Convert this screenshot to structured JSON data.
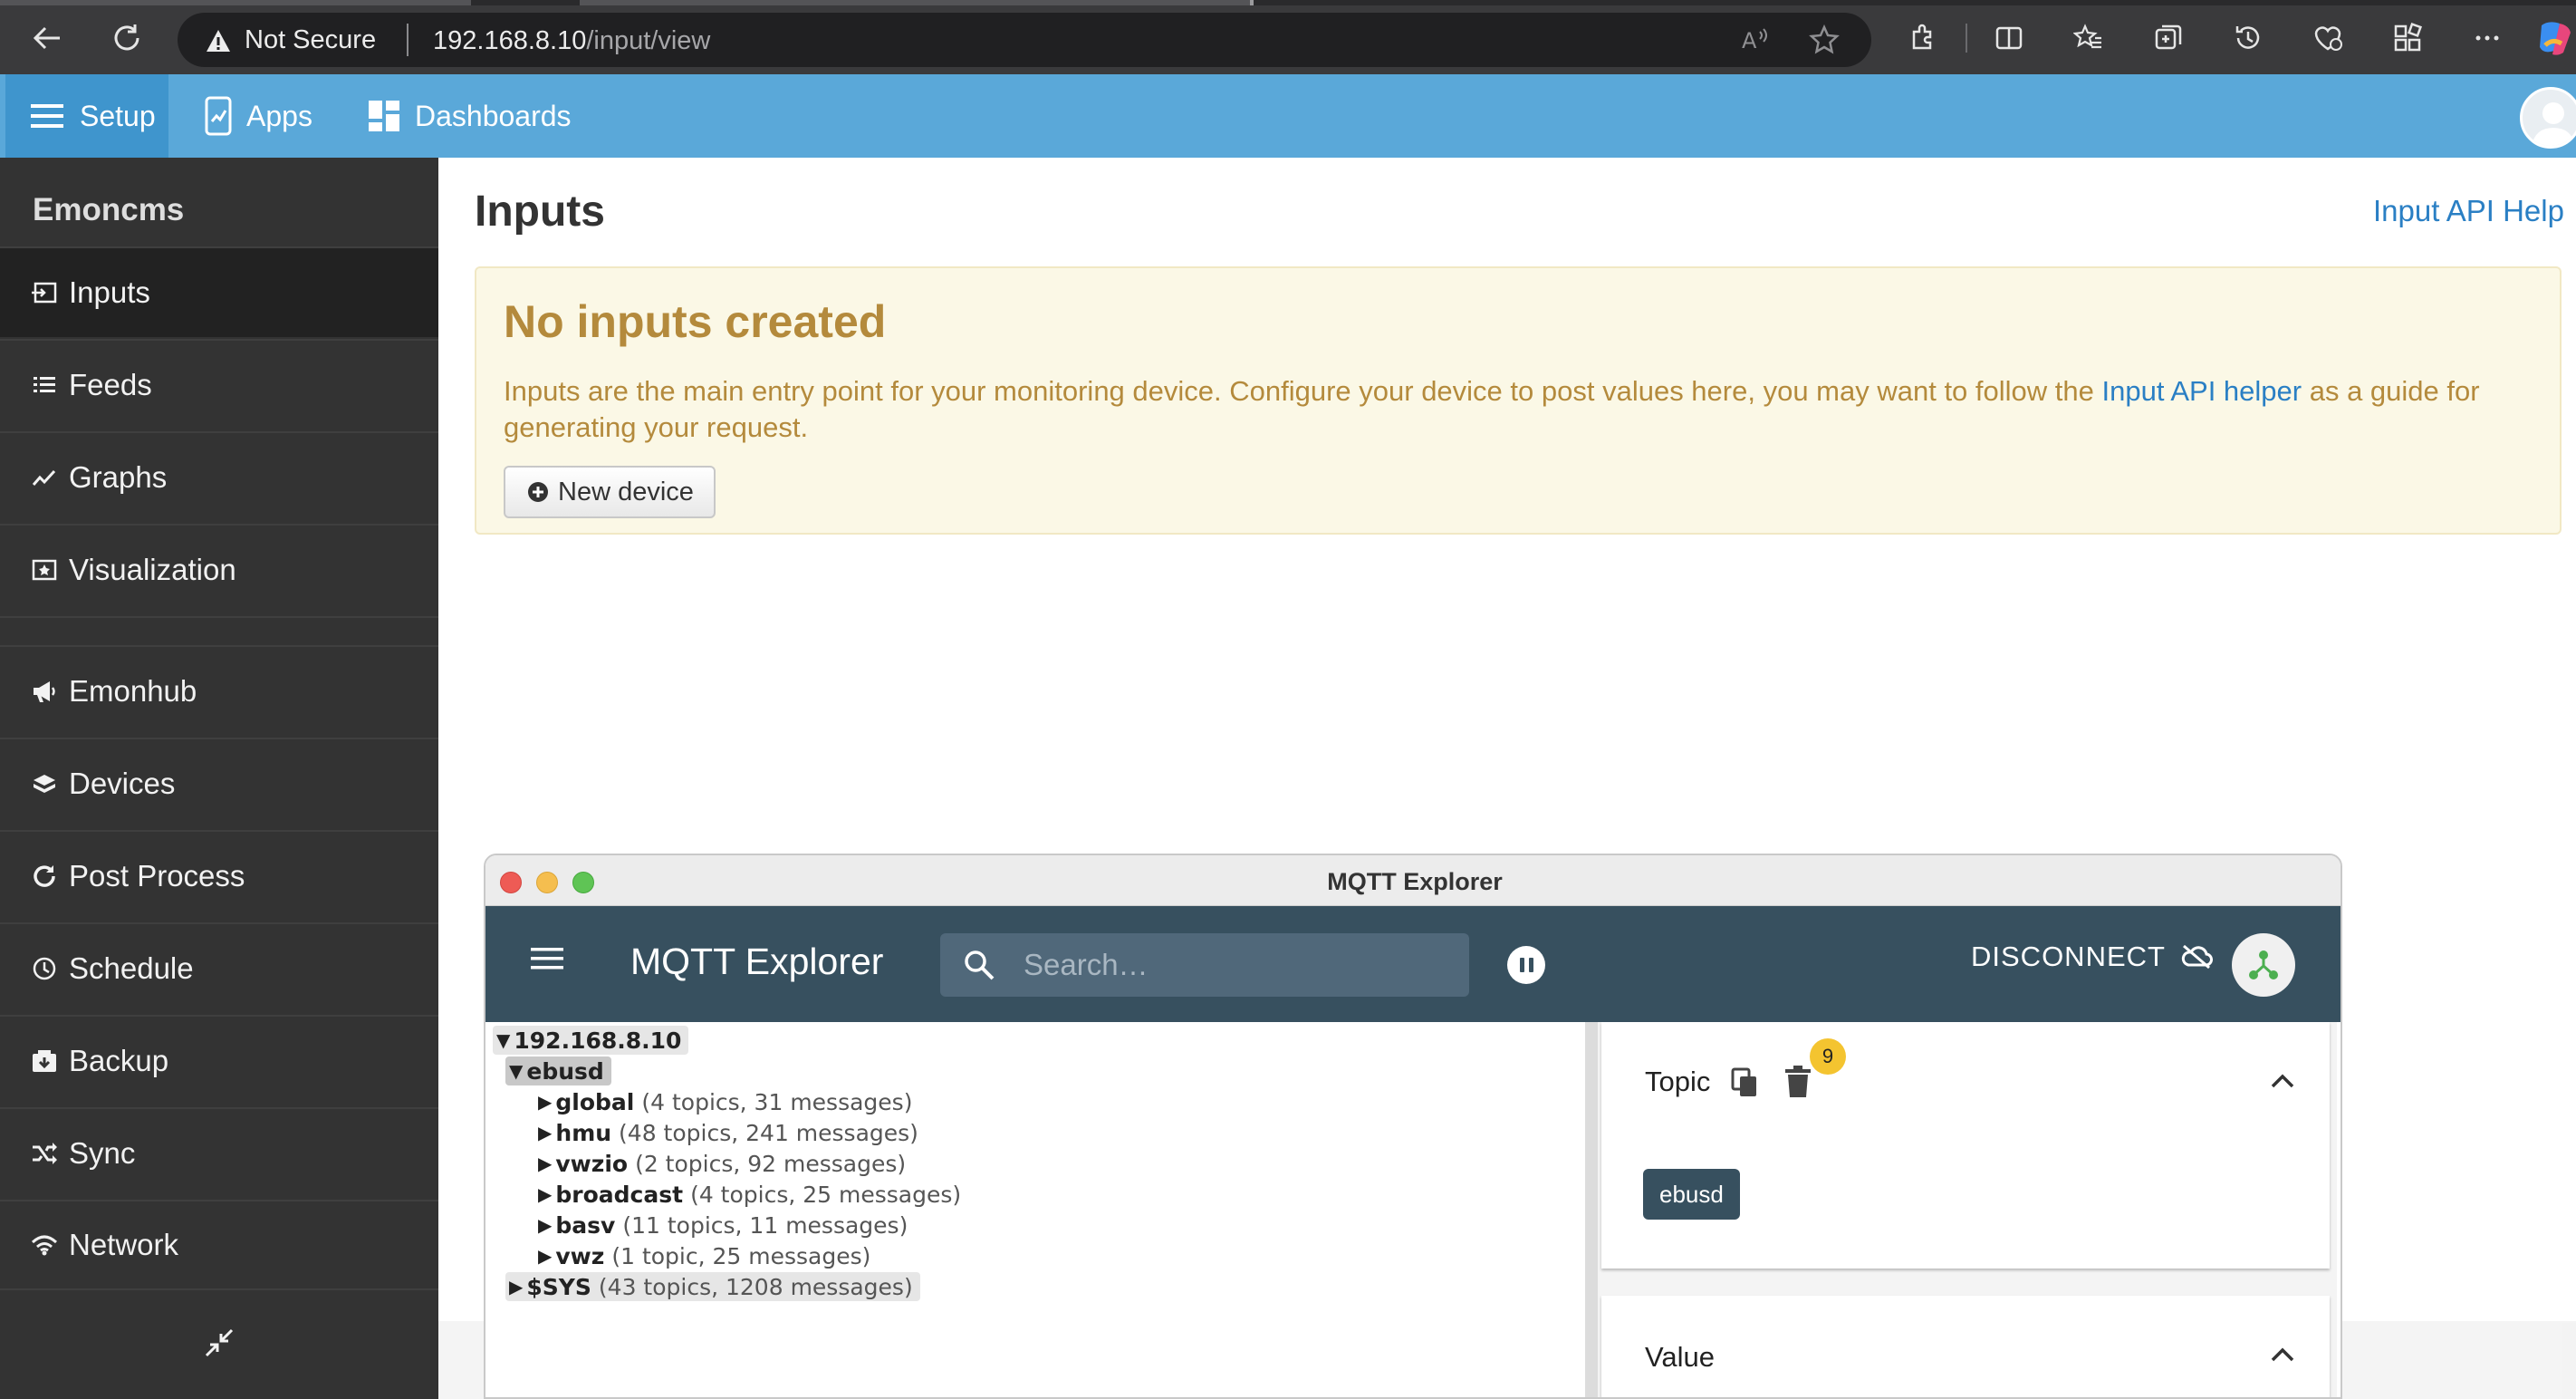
{
  "browser": {
    "security_label": "Not Secure",
    "url_host": "192.168.8.10",
    "url_path": "/input/view"
  },
  "topnav": {
    "setup_label": "Setup",
    "apps_label": "Apps",
    "dashboards_label": "Dashboards"
  },
  "sidebar": {
    "title": "Emoncms",
    "items": [
      {
        "label": "Inputs",
        "icon": "input-icon"
      },
      {
        "label": "Feeds",
        "icon": "list-icon"
      },
      {
        "label": "Graphs",
        "icon": "graph-icon"
      },
      {
        "label": "Visualization",
        "icon": "visualization-icon"
      },
      {
        "label": "Emonhub",
        "icon": "megaphone-icon"
      },
      {
        "label": "Devices",
        "icon": "devices-icon"
      },
      {
        "label": "Post Process",
        "icon": "refresh-icon"
      },
      {
        "label": "Schedule",
        "icon": "clock-icon"
      },
      {
        "label": "Backup",
        "icon": "backup-icon"
      },
      {
        "label": "Sync",
        "icon": "shuffle-icon"
      },
      {
        "label": "Network",
        "icon": "wifi-icon"
      }
    ]
  },
  "main": {
    "title": "Inputs",
    "api_help": "Input API Help",
    "alert": {
      "heading": "No inputs created",
      "text_before": "Inputs are the main entry point for your monitoring device. Configure your device to post values here, you may want to follow the ",
      "link": "Input API helper",
      "text_after": " as a guide for generating your request.",
      "button": "New device"
    }
  },
  "mqtt": {
    "window_title": "MQTT Explorer",
    "app_title": "MQTT Explorer",
    "search_placeholder": "Search…",
    "disconnect_label": "DISCONNECT",
    "tree": {
      "root": {
        "arrow": "▼",
        "name": "192.168.8.10"
      },
      "ebusd": {
        "arrow": "▼",
        "name": "ebusd"
      },
      "children": [
        {
          "arrow": "▶",
          "name": "global",
          "meta": "(4 topics, 31 messages)"
        },
        {
          "arrow": "▶",
          "name": "hmu",
          "meta": "(48 topics, 241 messages)"
        },
        {
          "arrow": "▶",
          "name": "vwzio",
          "meta": "(2 topics, 92 messages)"
        },
        {
          "arrow": "▶",
          "name": "broadcast",
          "meta": "(4 topics, 25 messages)"
        },
        {
          "arrow": "▶",
          "name": "basv",
          "meta": "(11 topics, 11 messages)"
        },
        {
          "arrow": "▶",
          "name": "vwz",
          "meta": "(1 topic, 25 messages)"
        }
      ],
      "sys": {
        "arrow": "▶",
        "name": "$SYS",
        "meta": "(43 topics, 1208 messages)"
      }
    },
    "detail": {
      "topic_label": "Topic",
      "message_count": "9",
      "topic_chip": "ebusd",
      "value_label": "Value"
    }
  },
  "colors": {
    "navbar": "#5aa8d9",
    "sidebar": "#333333",
    "alert_text": "#b48a3c",
    "link": "#2a7fc4",
    "mqtt_appbar": "#37505f",
    "badge": "#f4c430"
  }
}
